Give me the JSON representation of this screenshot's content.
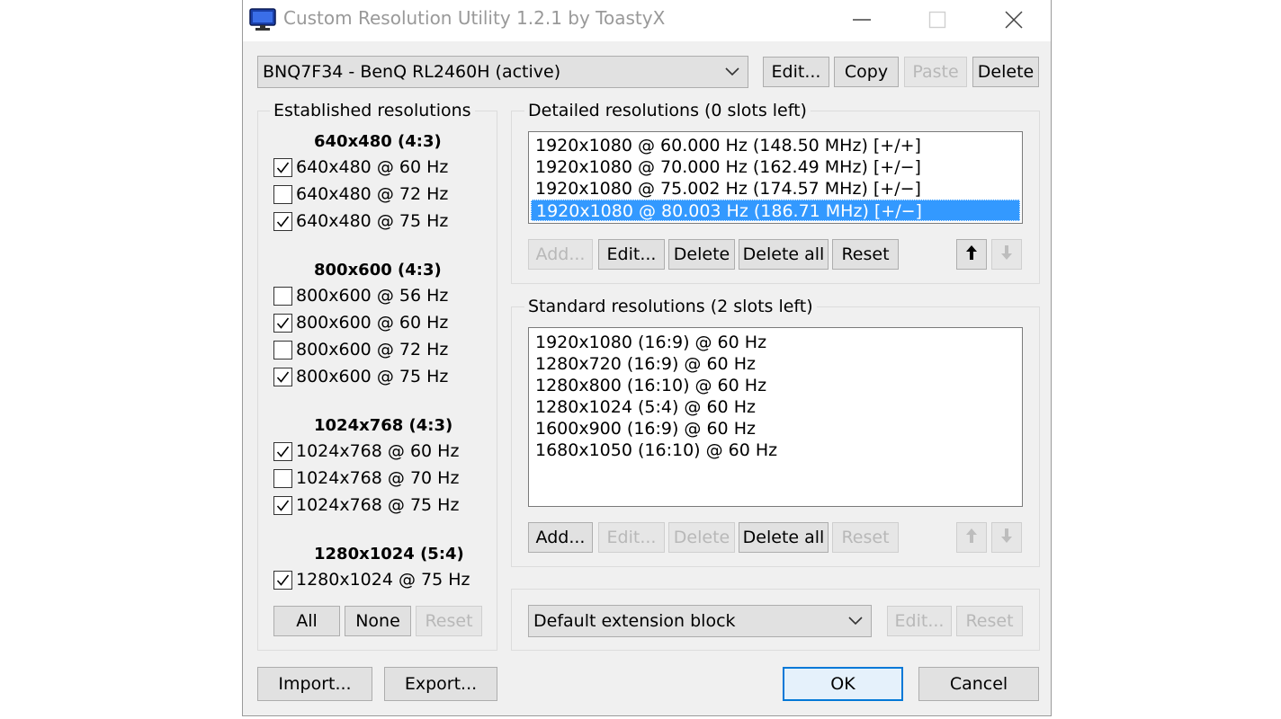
{
  "window": {
    "title": "Custom Resolution Utility 1.2.1 by ToastyX",
    "icon": "monitor-icon",
    "controls": [
      "minimize-icon",
      "maximize-icon",
      "close-icon"
    ]
  },
  "monitor": {
    "selected": "BNQ7F34 - BenQ RL2460H (active)",
    "buttons": {
      "edit": "Edit...",
      "copy": "Copy",
      "paste": "Paste",
      "delete": "Delete"
    }
  },
  "established": {
    "legend": "Established resolutions",
    "groups": [
      {
        "header": "640x480 (4:3)",
        "items": [
          {
            "label": "640x480 @ 60 Hz",
            "checked": true
          },
          {
            "label": "640x480 @ 72 Hz",
            "checked": false
          },
          {
            "label": "640x480 @ 75 Hz",
            "checked": true
          }
        ]
      },
      {
        "header": "800x600 (4:3)",
        "items": [
          {
            "label": "800x600 @ 56 Hz",
            "checked": false
          },
          {
            "label": "800x600 @ 60 Hz",
            "checked": true
          },
          {
            "label": "800x600 @ 72 Hz",
            "checked": false
          },
          {
            "label": "800x600 @ 75 Hz",
            "checked": true
          }
        ]
      },
      {
        "header": "1024x768 (4:3)",
        "items": [
          {
            "label": "1024x768 @ 60 Hz",
            "checked": true
          },
          {
            "label": "1024x768 @ 70 Hz",
            "checked": false
          },
          {
            "label": "1024x768 @ 75 Hz",
            "checked": true
          }
        ]
      },
      {
        "header": "1280x1024 (5:4)",
        "items": [
          {
            "label": "1280x1024 @ 75 Hz",
            "checked": true
          }
        ]
      }
    ],
    "buttons": {
      "all": "All",
      "none": "None",
      "reset": "Reset"
    }
  },
  "detailed": {
    "legend": "Detailed resolutions (0 slots left)",
    "items": [
      {
        "label": "1920x1080 @ 60.000 Hz (148.50 MHz) [+/+]",
        "selected": false
      },
      {
        "label": "1920x1080 @ 70.000 Hz (162.49 MHz) [+/−]",
        "selected": false
      },
      {
        "label": "1920x1080 @ 75.002 Hz (174.57 MHz) [+/−]",
        "selected": false
      },
      {
        "label": "1920x1080 @ 80.003 Hz (186.71 MHz) [+/−]",
        "selected": true
      }
    ],
    "buttons": {
      "add": "Add...",
      "edit": "Edit...",
      "delete": "Delete",
      "delete_all": "Delete all",
      "reset": "Reset"
    },
    "move_up_icon": "arrow-up-icon",
    "move_down_icon": "arrow-down-icon"
  },
  "standard": {
    "legend": "Standard resolutions (2 slots left)",
    "items": [
      {
        "label": "1920x1080 (16:9) @ 60 Hz"
      },
      {
        "label": "1280x720 (16:9) @ 60 Hz"
      },
      {
        "label": "1280x800 (16:10) @ 60 Hz"
      },
      {
        "label": "1280x1024 (5:4) @ 60 Hz"
      },
      {
        "label": "1600x900 (16:9) @ 60 Hz"
      },
      {
        "label": "1680x1050 (16:10) @ 60 Hz"
      }
    ],
    "buttons": {
      "add": "Add...",
      "edit": "Edit...",
      "delete": "Delete",
      "delete_all": "Delete all",
      "reset": "Reset"
    }
  },
  "extension": {
    "selected": "Default extension block",
    "buttons": {
      "edit": "Edit...",
      "reset": "Reset"
    }
  },
  "footer": {
    "import": "Import...",
    "export": "Export...",
    "ok": "OK",
    "cancel": "Cancel"
  },
  "colors": {
    "selection": "#3399ff",
    "window_bg": "#f0f0f0",
    "default_button_border": "#0078d7",
    "title_text": "#999999"
  }
}
